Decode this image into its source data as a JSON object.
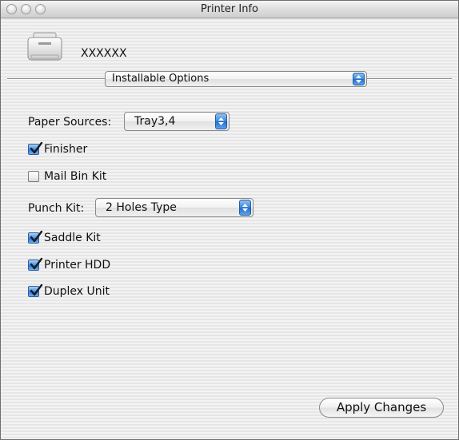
{
  "window": {
    "title": "Printer Info"
  },
  "printer": {
    "name": "XXXXXX",
    "icon": "printer-icon"
  },
  "section_popup": {
    "selected": "Installable Options"
  },
  "paper_sources": {
    "label": "Paper Sources:",
    "selected": "Tray3,4"
  },
  "options": {
    "finisher": {
      "label": "Finisher",
      "checked": true
    },
    "mail_bin_kit": {
      "label": "Mail Bin Kit",
      "checked": false
    },
    "saddle_kit": {
      "label": "Saddle Kit",
      "checked": true
    },
    "printer_hdd": {
      "label": "Printer HDD",
      "checked": true
    },
    "duplex_unit": {
      "label": "Duplex Unit",
      "checked": true
    }
  },
  "punch_kit": {
    "label": "Punch Kit:",
    "selected": "2 Holes Type"
  },
  "buttons": {
    "apply": "Apply Changes"
  },
  "colors": {
    "accent": "#3a86dd",
    "background": "#ececec"
  }
}
